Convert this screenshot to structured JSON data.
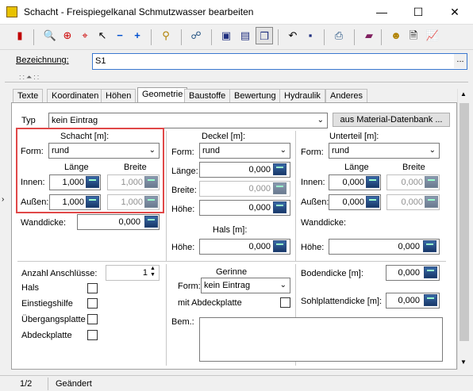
{
  "window": {
    "title": "Schacht - Freispiegelkanal Schmutzwasser bearbeiten",
    "minimize": "—",
    "maximize": "☐",
    "close": "✕"
  },
  "bezeichnung": {
    "label": "Bezeichnung:",
    "value": "S1",
    "dots": "..."
  },
  "tabs": [
    "Texte",
    "Koordinaten",
    "Höhen",
    "Geometrie",
    "Baustoffe",
    "Bewertung",
    "Hydraulik",
    "Anderes"
  ],
  "typ": {
    "label": "Typ",
    "value": "kein Eintrag",
    "button": "aus Material-Datenbank ..."
  },
  "schacht": {
    "title": "Schacht [m]:",
    "form_label": "Form:",
    "form_value": "rund",
    "col_laenge": "Länge",
    "col_breite": "Breite",
    "innen_label": "Innen:",
    "innen_laenge": "1,000",
    "innen_breite": "1,000",
    "aussen_label": "Außen:",
    "aussen_laenge": "1,000",
    "aussen_breite": "1,000",
    "wanddicke_label": "Wanddicke:",
    "wanddicke": "0,000"
  },
  "deckel": {
    "title": "Deckel [m]:",
    "form_label": "Form:",
    "form_value": "rund",
    "laenge_label": "Länge:",
    "laenge": "0,000",
    "breite_label": "Breite:",
    "breite": "0,000",
    "hoehe_label": "Höhe:",
    "hoehe": "0,000"
  },
  "hals": {
    "title": "Hals [m]:",
    "hoehe_label": "Höhe:",
    "hoehe": "0,000"
  },
  "unterteil": {
    "title": "Unterteil [m]:",
    "form_label": "Form:",
    "form_value": "rund",
    "col_laenge": "Länge",
    "col_breite": "Breite",
    "innen_label": "Innen:",
    "innen_laenge": "0,000",
    "innen_breite": "0,000",
    "aussen_label": "Außen:",
    "aussen_laenge": "0,000",
    "aussen_breite": "0,000",
    "wanddicke_label": "Wanddicke:",
    "hoehe_label": "Höhe:",
    "hoehe": "0,000"
  },
  "anschluesse": {
    "label": "Anzahl Anschlüsse:",
    "value": "1",
    "items": [
      "Hals",
      "Einstiegshilfe",
      "Übergangsplatte",
      "Abdeckplatte"
    ]
  },
  "gerinne": {
    "title": "Gerinne",
    "form_label": "Form:",
    "form_value": "kein Eintrag",
    "abdeck_label": "mit Abdeckplatte",
    "bem_label": "Bem.:"
  },
  "bodendicke": {
    "label": "Bodendicke [m]:",
    "value": "0,000"
  },
  "sohlplatte": {
    "label": "Sohlplattendicke [m]:",
    "value": "0,000"
  },
  "status": {
    "page": "1/2",
    "state": "Geändert"
  },
  "colors": {
    "highlight": "#e04848",
    "titlebar": "#ffffff",
    "face": "#f0f0f0"
  }
}
